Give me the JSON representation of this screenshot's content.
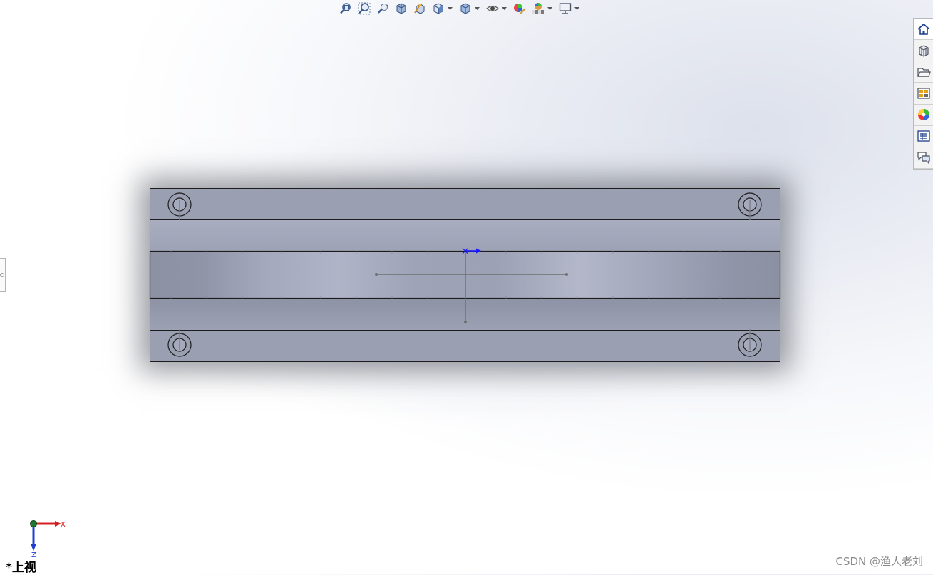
{
  "viewport": {
    "view_name": "*上视"
  },
  "heads_up_toolbar": {
    "items": [
      {
        "icon": "zoom-to-fit-icon",
        "dropdown": false
      },
      {
        "icon": "zoom-to-area-icon",
        "dropdown": false
      },
      {
        "icon": "previous-view-icon",
        "dropdown": false
      },
      {
        "icon": "section-view-icon",
        "dropdown": false
      },
      {
        "icon": "dynamic-annotation-views-icon",
        "dropdown": false
      },
      {
        "icon": "view-orientation-icon",
        "dropdown": true
      },
      {
        "icon": "display-style-icon",
        "dropdown": true
      },
      {
        "icon": "hide-show-items-icon",
        "dropdown": true
      },
      {
        "icon": "edit-appearance-icon",
        "dropdown": false
      },
      {
        "icon": "apply-scene-icon",
        "dropdown": true
      },
      {
        "icon": "view-settings-icon",
        "dropdown": true
      }
    ]
  },
  "task_pane": {
    "tabs": [
      {
        "icon": "solidworks-resources-icon",
        "active": true
      },
      {
        "icon": "design-library-icon",
        "active": false
      },
      {
        "icon": "file-explorer-icon",
        "active": false
      },
      {
        "icon": "view-palette-icon",
        "active": false
      },
      {
        "icon": "appearances-scenes-icon",
        "active": false
      },
      {
        "icon": "custom-properties-icon",
        "active": false
      },
      {
        "icon": "forum-icon",
        "active": false
      }
    ]
  },
  "triad": {
    "x_label": "X",
    "z_label": "Z"
  },
  "watermark": "CSDN @渔人老刘",
  "colors": {
    "part_face": "#999fb2",
    "part_channel": "#a4a9bd",
    "outline": "#1c1c1c",
    "origin_blue": "#1a1aff",
    "triad_x": "#d42020",
    "triad_z": "#1f3fd0"
  }
}
